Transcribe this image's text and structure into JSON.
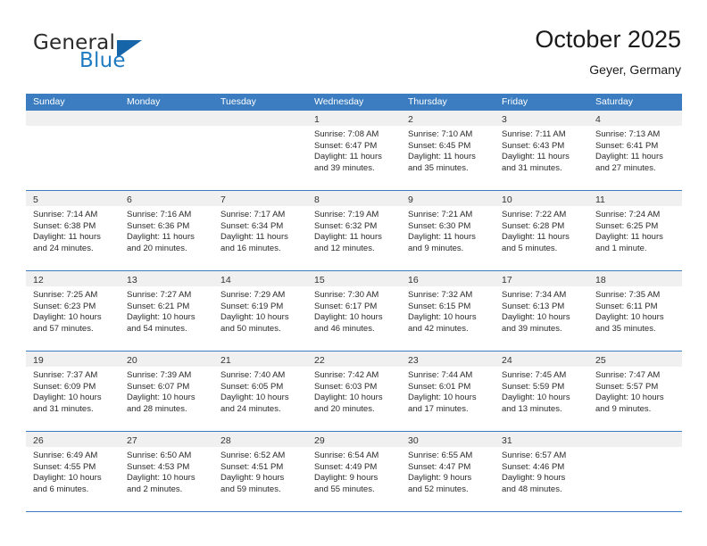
{
  "brand": {
    "name_top": "General",
    "name_bottom": "Blue",
    "accent_color": "#1f7bc1",
    "triangle_color": "#1565a8"
  },
  "header": {
    "title": "October 2025",
    "subtitle": "Geyer, Germany"
  },
  "theme": {
    "header_bar": "#3b7dc0",
    "day_strip": "#f0f0f0",
    "text": "#2a2a2a"
  },
  "weekdays": [
    "Sunday",
    "Monday",
    "Tuesday",
    "Wednesday",
    "Thursday",
    "Friday",
    "Saturday"
  ],
  "weeks": [
    [
      {
        "day": "",
        "empty": true
      },
      {
        "day": "",
        "empty": true
      },
      {
        "day": "",
        "empty": true
      },
      {
        "day": "1",
        "sunrise": "Sunrise: 7:08 AM",
        "sunset": "Sunset: 6:47 PM",
        "daylight1": "Daylight: 11 hours",
        "daylight2": "and 39 minutes."
      },
      {
        "day": "2",
        "sunrise": "Sunrise: 7:10 AM",
        "sunset": "Sunset: 6:45 PM",
        "daylight1": "Daylight: 11 hours",
        "daylight2": "and 35 minutes."
      },
      {
        "day": "3",
        "sunrise": "Sunrise: 7:11 AM",
        "sunset": "Sunset: 6:43 PM",
        "daylight1": "Daylight: 11 hours",
        "daylight2": "and 31 minutes."
      },
      {
        "day": "4",
        "sunrise": "Sunrise: 7:13 AM",
        "sunset": "Sunset: 6:41 PM",
        "daylight1": "Daylight: 11 hours",
        "daylight2": "and 27 minutes."
      }
    ],
    [
      {
        "day": "5",
        "sunrise": "Sunrise: 7:14 AM",
        "sunset": "Sunset: 6:38 PM",
        "daylight1": "Daylight: 11 hours",
        "daylight2": "and 24 minutes."
      },
      {
        "day": "6",
        "sunrise": "Sunrise: 7:16 AM",
        "sunset": "Sunset: 6:36 PM",
        "daylight1": "Daylight: 11 hours",
        "daylight2": "and 20 minutes."
      },
      {
        "day": "7",
        "sunrise": "Sunrise: 7:17 AM",
        "sunset": "Sunset: 6:34 PM",
        "daylight1": "Daylight: 11 hours",
        "daylight2": "and 16 minutes."
      },
      {
        "day": "8",
        "sunrise": "Sunrise: 7:19 AM",
        "sunset": "Sunset: 6:32 PM",
        "daylight1": "Daylight: 11 hours",
        "daylight2": "and 12 minutes."
      },
      {
        "day": "9",
        "sunrise": "Sunrise: 7:21 AM",
        "sunset": "Sunset: 6:30 PM",
        "daylight1": "Daylight: 11 hours",
        "daylight2": "and 9 minutes."
      },
      {
        "day": "10",
        "sunrise": "Sunrise: 7:22 AM",
        "sunset": "Sunset: 6:28 PM",
        "daylight1": "Daylight: 11 hours",
        "daylight2": "and 5 minutes."
      },
      {
        "day": "11",
        "sunrise": "Sunrise: 7:24 AM",
        "sunset": "Sunset: 6:25 PM",
        "daylight1": "Daylight: 11 hours",
        "daylight2": "and 1 minute."
      }
    ],
    [
      {
        "day": "12",
        "sunrise": "Sunrise: 7:25 AM",
        "sunset": "Sunset: 6:23 PM",
        "daylight1": "Daylight: 10 hours",
        "daylight2": "and 57 minutes."
      },
      {
        "day": "13",
        "sunrise": "Sunrise: 7:27 AM",
        "sunset": "Sunset: 6:21 PM",
        "daylight1": "Daylight: 10 hours",
        "daylight2": "and 54 minutes."
      },
      {
        "day": "14",
        "sunrise": "Sunrise: 7:29 AM",
        "sunset": "Sunset: 6:19 PM",
        "daylight1": "Daylight: 10 hours",
        "daylight2": "and 50 minutes."
      },
      {
        "day": "15",
        "sunrise": "Sunrise: 7:30 AM",
        "sunset": "Sunset: 6:17 PM",
        "daylight1": "Daylight: 10 hours",
        "daylight2": "and 46 minutes."
      },
      {
        "day": "16",
        "sunrise": "Sunrise: 7:32 AM",
        "sunset": "Sunset: 6:15 PM",
        "daylight1": "Daylight: 10 hours",
        "daylight2": "and 42 minutes."
      },
      {
        "day": "17",
        "sunrise": "Sunrise: 7:34 AM",
        "sunset": "Sunset: 6:13 PM",
        "daylight1": "Daylight: 10 hours",
        "daylight2": "and 39 minutes."
      },
      {
        "day": "18",
        "sunrise": "Sunrise: 7:35 AM",
        "sunset": "Sunset: 6:11 PM",
        "daylight1": "Daylight: 10 hours",
        "daylight2": "and 35 minutes."
      }
    ],
    [
      {
        "day": "19",
        "sunrise": "Sunrise: 7:37 AM",
        "sunset": "Sunset: 6:09 PM",
        "daylight1": "Daylight: 10 hours",
        "daylight2": "and 31 minutes."
      },
      {
        "day": "20",
        "sunrise": "Sunrise: 7:39 AM",
        "sunset": "Sunset: 6:07 PM",
        "daylight1": "Daylight: 10 hours",
        "daylight2": "and 28 minutes."
      },
      {
        "day": "21",
        "sunrise": "Sunrise: 7:40 AM",
        "sunset": "Sunset: 6:05 PM",
        "daylight1": "Daylight: 10 hours",
        "daylight2": "and 24 minutes."
      },
      {
        "day": "22",
        "sunrise": "Sunrise: 7:42 AM",
        "sunset": "Sunset: 6:03 PM",
        "daylight1": "Daylight: 10 hours",
        "daylight2": "and 20 minutes."
      },
      {
        "day": "23",
        "sunrise": "Sunrise: 7:44 AM",
        "sunset": "Sunset: 6:01 PM",
        "daylight1": "Daylight: 10 hours",
        "daylight2": "and 17 minutes."
      },
      {
        "day": "24",
        "sunrise": "Sunrise: 7:45 AM",
        "sunset": "Sunset: 5:59 PM",
        "daylight1": "Daylight: 10 hours",
        "daylight2": "and 13 minutes."
      },
      {
        "day": "25",
        "sunrise": "Sunrise: 7:47 AM",
        "sunset": "Sunset: 5:57 PM",
        "daylight1": "Daylight: 10 hours",
        "daylight2": "and 9 minutes."
      }
    ],
    [
      {
        "day": "26",
        "sunrise": "Sunrise: 6:49 AM",
        "sunset": "Sunset: 4:55 PM",
        "daylight1": "Daylight: 10 hours",
        "daylight2": "and 6 minutes."
      },
      {
        "day": "27",
        "sunrise": "Sunrise: 6:50 AM",
        "sunset": "Sunset: 4:53 PM",
        "daylight1": "Daylight: 10 hours",
        "daylight2": "and 2 minutes."
      },
      {
        "day": "28",
        "sunrise": "Sunrise: 6:52 AM",
        "sunset": "Sunset: 4:51 PM",
        "daylight1": "Daylight: 9 hours",
        "daylight2": "and 59 minutes."
      },
      {
        "day": "29",
        "sunrise": "Sunrise: 6:54 AM",
        "sunset": "Sunset: 4:49 PM",
        "daylight1": "Daylight: 9 hours",
        "daylight2": "and 55 minutes."
      },
      {
        "day": "30",
        "sunrise": "Sunrise: 6:55 AM",
        "sunset": "Sunset: 4:47 PM",
        "daylight1": "Daylight: 9 hours",
        "daylight2": "and 52 minutes."
      },
      {
        "day": "31",
        "sunrise": "Sunrise: 6:57 AM",
        "sunset": "Sunset: 4:46 PM",
        "daylight1": "Daylight: 9 hours",
        "daylight2": "and 48 minutes."
      },
      {
        "day": "",
        "empty": true
      }
    ]
  ]
}
